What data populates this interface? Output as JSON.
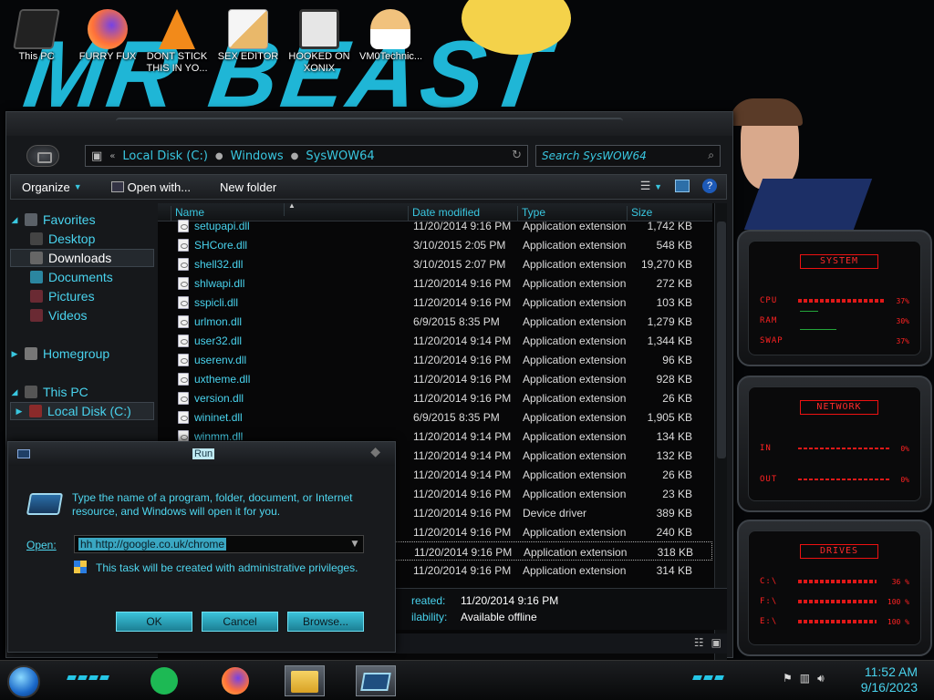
{
  "desktop": {
    "wallpaper_text": "MR BEAST",
    "icons": [
      {
        "label": "This PC",
        "icon": "computer-icon"
      },
      {
        "label": "FURRY FUX",
        "icon": "firefox-icon"
      },
      {
        "label": "DONT STICK THIS IN YO...",
        "icon": "vlc-cone-icon"
      },
      {
        "label": "SEX EDITOR",
        "icon": "hxd-editor-icon"
      },
      {
        "label": "HOOKED ON XONIX",
        "icon": "game-icon"
      },
      {
        "label": "VM0Technic...",
        "icon": "doctor-icon"
      }
    ]
  },
  "explorer": {
    "breadcrumb": [
      "Local Disk (C:)",
      "Windows",
      "SysWOW64"
    ],
    "search_placeholder": "Search SysWOW64",
    "toolbar": {
      "organize": "Organize",
      "open_with": "Open with...",
      "new_folder": "New folder"
    },
    "nav": {
      "favorites": "Favorites",
      "desktop": "Desktop",
      "downloads": "Downloads",
      "documents": "Documents",
      "pictures": "Pictures",
      "videos": "Videos",
      "homegroup": "Homegroup",
      "this_pc": "This PC",
      "local_disk": "Local Disk (C:)"
    },
    "columns": {
      "name": "Name",
      "date": "Date modified",
      "type": "Type",
      "size": "Size"
    },
    "files": [
      {
        "name": "setupapi.dll",
        "date": "11/20/2014 9:16 PM",
        "type": "Application extension",
        "size": "1,742 KB"
      },
      {
        "name": "SHCore.dll",
        "date": "3/10/2015 2:05 PM",
        "type": "Application extension",
        "size": "548 KB"
      },
      {
        "name": "shell32.dll",
        "date": "3/10/2015 2:07 PM",
        "type": "Application extension",
        "size": "19,270 KB"
      },
      {
        "name": "shlwapi.dll",
        "date": "11/20/2014 9:16 PM",
        "type": "Application extension",
        "size": "272 KB"
      },
      {
        "name": "sspicli.dll",
        "date": "11/20/2014 9:16 PM",
        "type": "Application extension",
        "size": "103 KB"
      },
      {
        "name": "urlmon.dll",
        "date": "6/9/2015 8:35 PM",
        "type": "Application extension",
        "size": "1,279 KB"
      },
      {
        "name": "user32.dll",
        "date": "11/20/2014 9:14 PM",
        "type": "Application extension",
        "size": "1,344 KB"
      },
      {
        "name": "userenv.dll",
        "date": "11/20/2014 9:16 PM",
        "type": "Application extension",
        "size": "96 KB"
      },
      {
        "name": "uxtheme.dll",
        "date": "11/20/2014 9:16 PM",
        "type": "Application extension",
        "size": "928 KB"
      },
      {
        "name": "version.dll",
        "date": "11/20/2014 9:16 PM",
        "type": "Application extension",
        "size": "26 KB"
      },
      {
        "name": "wininet.dll",
        "date": "6/9/2015 8:35 PM",
        "type": "Application extension",
        "size": "1,905 KB"
      },
      {
        "name": "winmm.dll",
        "date": "11/20/2014 9:14 PM",
        "type": "Application extension",
        "size": "134 KB"
      },
      {
        "name": "",
        "date": "11/20/2014 9:14 PM",
        "type": "Application extension",
        "size": "132 KB"
      },
      {
        "name": "",
        "date": "11/20/2014 9:14 PM",
        "type": "Application extension",
        "size": "26 KB"
      },
      {
        "name": "",
        "date": "11/20/2014 9:16 PM",
        "type": "Application extension",
        "size": "23 KB"
      },
      {
        "name": "",
        "date": "11/20/2014 9:16 PM",
        "type": "Device driver",
        "size": "389 KB"
      },
      {
        "name": "",
        "date": "11/20/2014 9:16 PM",
        "type": "Application extension",
        "size": "240 KB"
      },
      {
        "name": "",
        "date": "11/20/2014 9:16 PM",
        "type": "Application extension",
        "size": "318 KB"
      },
      {
        "name": "",
        "date": "11/20/2014 9:16 PM",
        "type": "Application extension",
        "size": "314 KB"
      }
    ],
    "details": {
      "created_label": "reated:",
      "created_value": "11/20/2014 9:16 PM",
      "availability_label": "ilability:",
      "availability_value": "Available offline"
    }
  },
  "run": {
    "title": "Run",
    "message": "Type the name of a program, folder, document, or Internet resource, and Windows will open it for you.",
    "open_label": "Open:",
    "open_value": "hh http://google.co.uk/chrome",
    "admin_note": "This task will be created with administrative privileges.",
    "ok": "OK",
    "cancel": "Cancel",
    "browse": "Browse..."
  },
  "widgets": {
    "system": {
      "title": "SYSTEM",
      "rows": [
        {
          "label": "CPU",
          "value": "37%",
          "level": 0.37
        },
        {
          "label": "RAM",
          "value": "30%",
          "level": 0.3
        },
        {
          "label": "SWAP",
          "value": "37%",
          "level": 0.37
        }
      ]
    },
    "network": {
      "title": "NETWORK",
      "rows": [
        {
          "label": "IN",
          "value": "0%"
        },
        {
          "label": "OUT",
          "value": "0%"
        }
      ]
    },
    "drives": {
      "title": "DRIVES",
      "rows": [
        {
          "label": "C:\\",
          "value": "36 %",
          "level": 0.36
        },
        {
          "label": "F:\\",
          "value": "100 %",
          "level": 1.0
        },
        {
          "label": "E:\\",
          "value": "100 %",
          "level": 1.0
        }
      ]
    }
  },
  "taskbar": {
    "time": "11:52 AM",
    "date": "9/16/2023"
  },
  "colors": {
    "accent": "#39c7e0",
    "widget_red": "#ff2222",
    "background": "#070708"
  }
}
